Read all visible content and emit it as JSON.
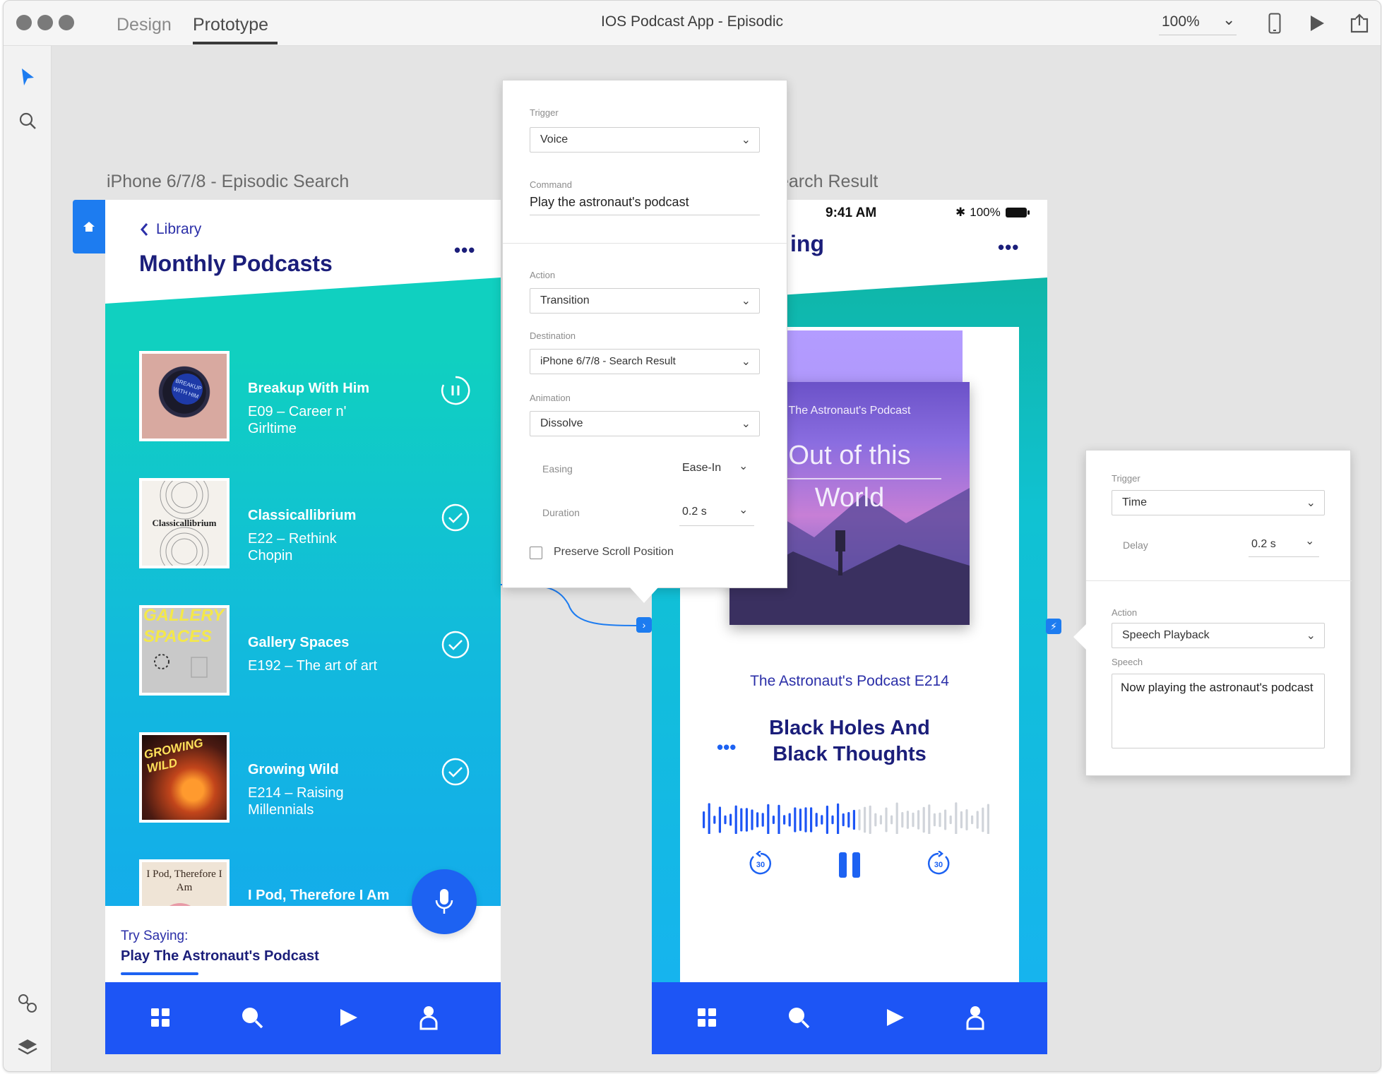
{
  "titlebar": {
    "mode_tabs": [
      "Design",
      "Prototype"
    ],
    "active_mode": "Prototype",
    "document_title": "IOS Podcast App - Episodic",
    "zoom": "100%"
  },
  "artboards": {
    "left_label": "iPhone 6/7/8 - Episodic Search",
    "right_label_visible": "earch Result"
  },
  "search_screen": {
    "back_label": "Library",
    "title": "Monthly Podcasts",
    "podcasts": [
      {
        "title": "Breakup With Him",
        "subtitle": "E09 – Career n' Girltime",
        "art_text": "BREAKUP WITH HIM",
        "status": "playing"
      },
      {
        "title": "Classicallibrium",
        "subtitle": "E22 – Rethink Chopin",
        "art_text": "Classicallibrium",
        "status": "done"
      },
      {
        "title": "Gallery Spaces",
        "subtitle": "E192 – The art of art",
        "art_text": "GALLERY SPACES",
        "status": "done"
      },
      {
        "title": "Growing Wild",
        "subtitle": "E214 – Raising Millennials",
        "art_text": "GROWING WILD",
        "status": "done"
      },
      {
        "title": "I Pod, Therefore I Am",
        "subtitle": "",
        "art_text": "I Pod, Therefore I Am",
        "status": ""
      }
    ],
    "try_saying_label": "Try Saying:",
    "try_saying_value": "Play The Astronaut's Podcast"
  },
  "result_screen": {
    "status_time": "9:41 AM",
    "status_battery": "100%",
    "title_partial": "ing",
    "cover_small_text": "The Astronaut's Podcast",
    "cover_big_line1": "Out of this",
    "cover_big_line2": "World",
    "episode_label": "The Astronaut's Podcast E214",
    "episode_title_line1": "Black Holes And",
    "episode_title_line2": "Black Thoughts",
    "skip_back_seconds": "30",
    "skip_forward_seconds": "30"
  },
  "voice_panel": {
    "trigger_label": "Trigger",
    "trigger_value": "Voice",
    "command_label": "Command",
    "command_value": "Play the astronaut's podcast",
    "action_label": "Action",
    "action_value": "Transition",
    "destination_label": "Destination",
    "destination_value": "iPhone 6/7/8 - Search Result",
    "animation_label": "Animation",
    "animation_value": "Dissolve",
    "easing_label": "Easing",
    "easing_value": "Ease-In",
    "duration_label": "Duration",
    "duration_value": "0.2 s",
    "preserve_scroll_label": "Preserve Scroll Position",
    "preserve_scroll_checked": false
  },
  "time_panel": {
    "trigger_label": "Trigger",
    "trigger_value": "Time",
    "delay_label": "Delay",
    "delay_value": "0.2 s",
    "action_label": "Action",
    "action_value": "Speech Playback",
    "speech_label": "Speech",
    "speech_value": "Now playing the astronaut's podcast"
  },
  "colors": {
    "accent_blue": "#1d55f5",
    "navy_text": "#1b1e7a",
    "teal": "#10d0c0",
    "cyan": "#14a9ee"
  }
}
